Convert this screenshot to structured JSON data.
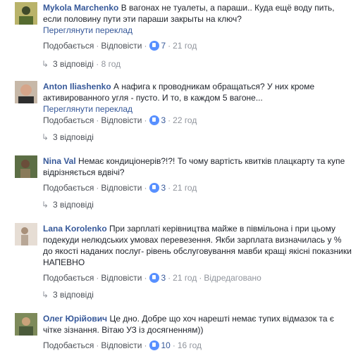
{
  "comments": [
    {
      "author": "Mykola Marchenko",
      "text": "В вагонах не туалеты, а параши.. Куда ещё воду пить, если половину пути эти параши закрыты на ключ?",
      "translate": "Переглянути переклад",
      "like_label": "Подобається",
      "reply_label": "Відповісти",
      "likes": "7",
      "time": "21 год",
      "replies_label": "3 відповіді",
      "replies_time": "8 год",
      "extra": ""
    },
    {
      "author": "Anton Iliashenko",
      "text": "А нафига к проводникам обращаться? У них кроме активированного угля - пусто. И то, в каждом 5 вагоне...",
      "translate": "Переглянути переклад",
      "like_label": "Подобається",
      "reply_label": "Відповісти",
      "likes": "3",
      "time": "22 год",
      "replies_label": "3 відповіді",
      "replies_time": "",
      "extra": ""
    },
    {
      "author": "Nina Val",
      "text": "Немає кондиціонерів?!?! То чому вартість квитків плацкарту та купе відрізняється вдвічі?",
      "translate": "",
      "like_label": "Подобається",
      "reply_label": "Відповісти",
      "likes": "3",
      "time": "21 год",
      "replies_label": "3 відповіді",
      "replies_time": "",
      "extra": ""
    },
    {
      "author": "Lana Korolenko",
      "text": "При зарплаті керівництва майже в півмільона і при цьому подекуди нелюдських умовах перевезення. Якби зарплата визначилась у % до якості наданих послуг- рівень обслуговування мавби кращі якісні показники НАПЕВНО",
      "translate": "",
      "like_label": "Подобається",
      "reply_label": "Відповісти",
      "likes": "3",
      "time": "21 год",
      "replies_label": "3 відповіді",
      "replies_time": "",
      "extra": "Відредаговано"
    },
    {
      "author": "Олег Юрійович",
      "text": "Це дно. Добре що хоч нарешті немає тупих відмазок та є чітке зізнання. Вітаю УЗ із досягненням))",
      "translate": "",
      "like_label": "Подобається",
      "reply_label": "Відповісти",
      "likes": "10",
      "time": "16 год",
      "replies_label": "",
      "replies_time": "",
      "extra": ""
    }
  ],
  "colors": {
    "link": "#365899",
    "meta": "#90949c",
    "like": "#5890ff"
  },
  "icons": {
    "like": "like-thumb-icon",
    "reply": "reply-arrow-icon"
  }
}
